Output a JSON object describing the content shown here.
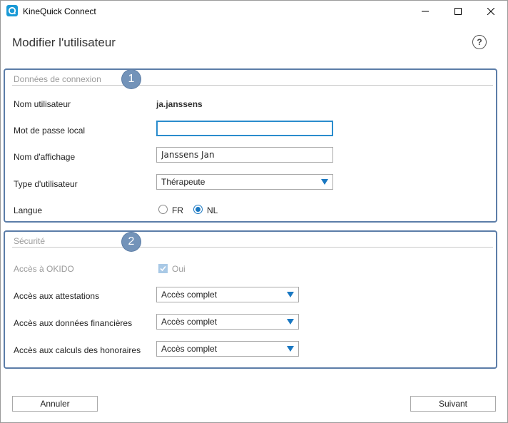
{
  "window": {
    "title": "KineQuick Connect"
  },
  "header": {
    "title": "Modifier l'utilisateur",
    "help": "?"
  },
  "section1": {
    "title": "Données de connexion",
    "badge": "1",
    "username_label": "Nom utilisateur",
    "username_value": "ja.janssens",
    "password_label": "Mot de passe local",
    "password_value": "",
    "display_label": "Nom d'affichage",
    "display_value": "Janssens Jan",
    "type_label": "Type d'utilisateur",
    "type_value": "Thérapeute",
    "lang_label": "Langue",
    "lang_fr": "FR",
    "lang_nl": "NL",
    "lang_selected": "NL"
  },
  "section2": {
    "title": "Sécurité",
    "badge": "2",
    "okido_label": "Accès à OKIDO",
    "okido_check": "Oui",
    "attest_label": "Accès aux attestations",
    "attest_value": "Accès complet",
    "fin_label": "Accès aux données financières",
    "fin_value": "Accès complet",
    "fees_label": "Accès aux calculs des honoraires",
    "fees_value": "Accès complet"
  },
  "footer": {
    "cancel": "Annuler",
    "next": "Suivant"
  },
  "colors": {
    "accent": "#1a78c2",
    "badge": "#7393b9",
    "section_border": "#5c7da8"
  }
}
